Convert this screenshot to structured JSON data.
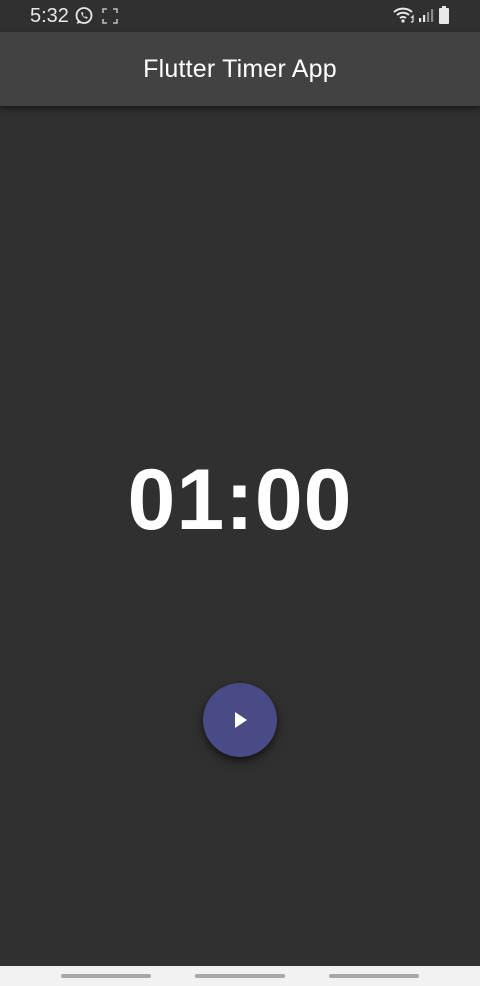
{
  "status_bar": {
    "time": "5:32",
    "icons": [
      "whatsapp-icon",
      "screenshot-icon",
      "wifi-icon",
      "signal-icon",
      "battery-icon"
    ]
  },
  "app_bar": {
    "title": "Flutter Timer App"
  },
  "timer": {
    "display": "01:00"
  },
  "fab": {
    "icon": "play-icon"
  },
  "nav_bar": {
    "icons": [
      "recent-apps-pill",
      "home-pill",
      "back-pill"
    ]
  },
  "colors": {
    "background": "#303030",
    "app_bar": "#424242",
    "fab": "#4a4a86",
    "text": "#ffffff"
  }
}
